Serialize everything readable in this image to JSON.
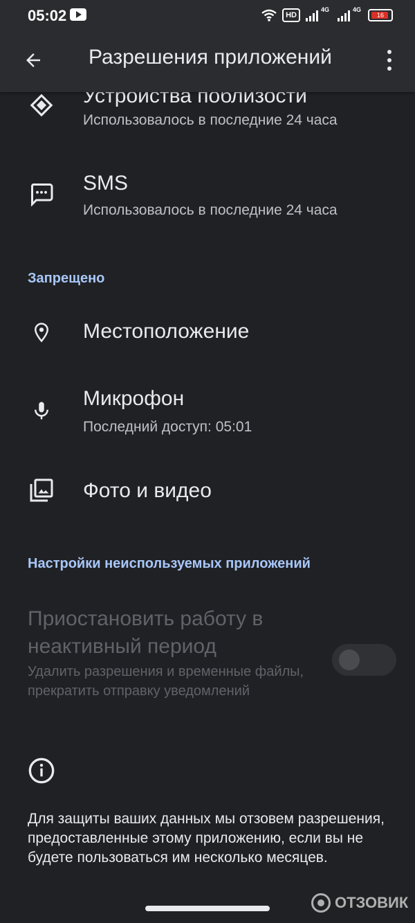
{
  "status_bar": {
    "time": "05:02",
    "hd": "HD",
    "network1": "4G",
    "network2": "4G",
    "battery": "16"
  },
  "header": {
    "title": "Разрешения приложений",
    "back_icon": "arrow-back-icon",
    "more_icon": "more-vert-icon"
  },
  "allowed_items": [
    {
      "title": "Устройства поблизости",
      "subtitle": "Использовалось в последние 24 часа",
      "icon": "nearby-devices-icon"
    },
    {
      "title": "SMS",
      "subtitle": "Использовалось в последние 24 часа",
      "icon": "sms-icon"
    }
  ],
  "denied_section": {
    "header": "Запрещено",
    "items": [
      {
        "title": "Местоположение",
        "icon": "location-icon"
      },
      {
        "title": "Микрофон",
        "subtitle": "Последний доступ: 05:01",
        "icon": "microphone-icon"
      },
      {
        "title": "Фото и видео",
        "icon": "photos-icon"
      }
    ]
  },
  "unused_section": {
    "header": "Настройки неиспользуемых приложений",
    "pause_title": "Приостановить работу в неактивный период",
    "pause_desc": "Удалить разрешения и временные файлы, прекратить отправку уведомлений",
    "toggle_on": false
  },
  "info": {
    "icon": "info-icon",
    "text": "Для защиты ваших данных мы отзовем разрешения, предоставленные этому приложению, если вы не будете пользоваться им несколько месяцев."
  },
  "watermark": "ОТЗОВИК",
  "colors": {
    "background": "#202124",
    "topbar": "#2b2c2f",
    "accent": "#a8c7fa",
    "disabled": "#5f6368"
  }
}
